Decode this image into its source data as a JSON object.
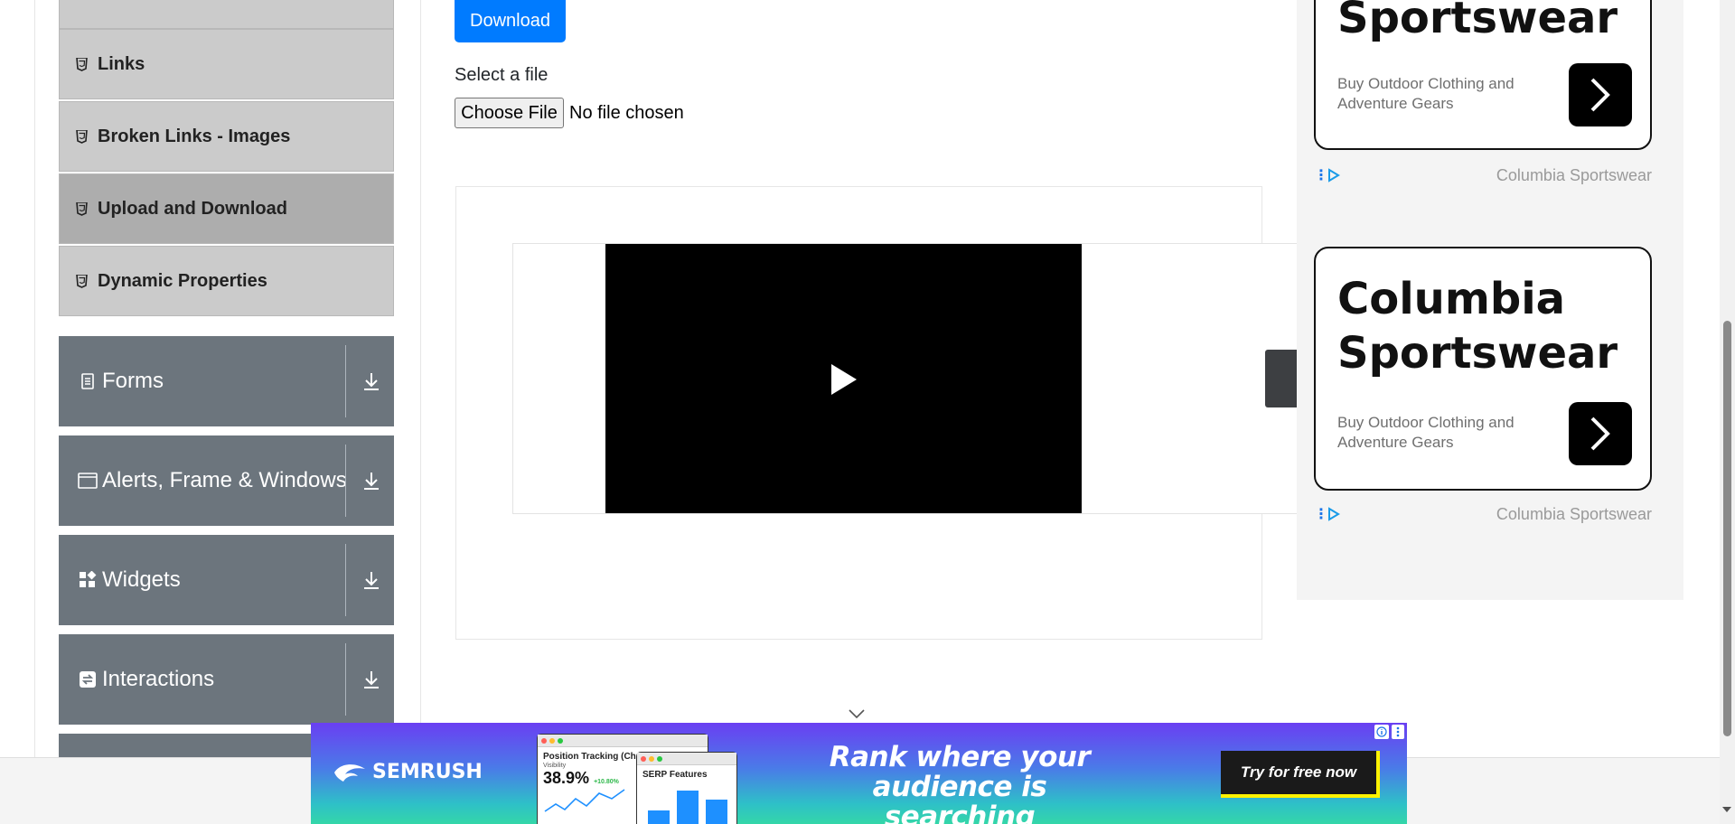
{
  "sidebar": {
    "elements_items": [
      {
        "label": "Links",
        "icon": "html5-icon",
        "active": false
      },
      {
        "label": "Broken Links - Images",
        "icon": "html5-icon",
        "active": false
      },
      {
        "label": "Upload and Download",
        "icon": "html5-icon",
        "active": true
      },
      {
        "label": "Dynamic Properties",
        "icon": "html5-icon",
        "active": false
      }
    ],
    "groups": [
      {
        "label": "Forms",
        "icon": "form-icon"
      },
      {
        "label": "Alerts, Frame & Windows",
        "icon": "window-icon"
      },
      {
        "label": "Widgets",
        "icon": "widgets-icon"
      },
      {
        "label": "Interactions",
        "icon": "interactions-icon"
      }
    ]
  },
  "main": {
    "download_label": "Download",
    "select_file_label": "Select a file",
    "choose_file_label": "Choose File",
    "file_status": "No file chosen"
  },
  "right_ads": [
    {
      "title_line1": "",
      "title_line2": "Sportswear",
      "description": "Buy Outdoor Clothing and Adventure Gears",
      "brand": "Columbia Sportswear"
    },
    {
      "title_line1": "Columbia",
      "title_line2": "Sportswear",
      "description": "Buy Outdoor Clothing and Adventure Gears",
      "brand": "Columbia Sportswear"
    }
  ],
  "banner": {
    "logo": "SEMRUSH",
    "mock1_title": "Position Tracking (ChatG",
    "mock1_sub": "Visibility",
    "mock1_value": "38.9%",
    "mock1_delta": "+10.80%",
    "mock2_title": "SERP Features",
    "headline": "Rank where your audience is searching",
    "cta": "Try for free now"
  },
  "colors": {
    "primary_button": "#007bff",
    "sidebar_group": "#6c757d",
    "sidebar_item": "#cbcbcb",
    "sidebar_item_active": "#adadad"
  }
}
